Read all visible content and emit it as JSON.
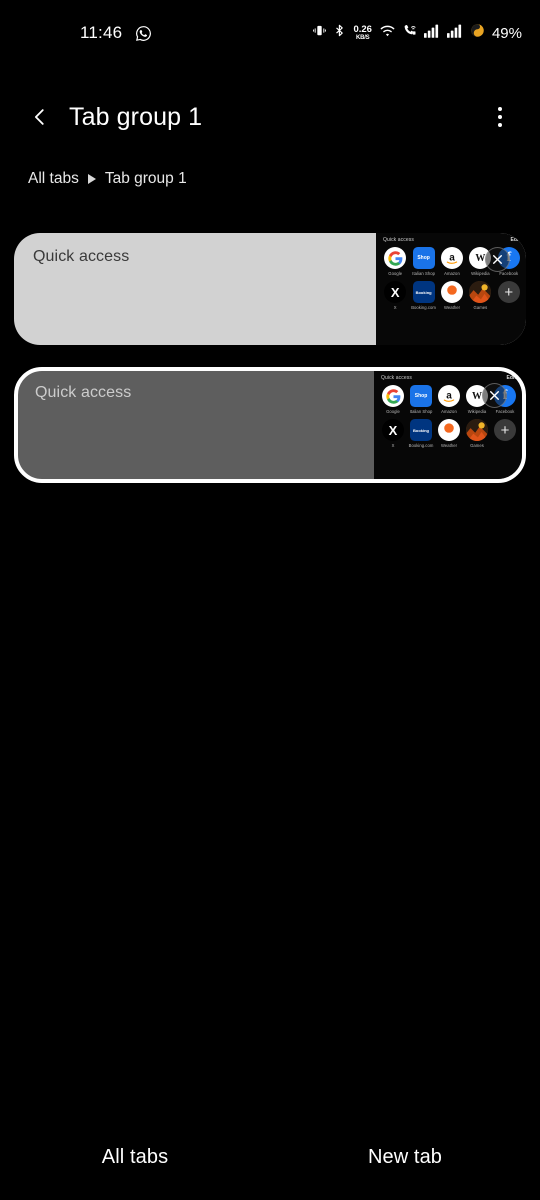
{
  "statusbar": {
    "time": "11:46",
    "whatsapp_icon": "whatsapp-icon",
    "vibrate_icon": "vibrate-icon",
    "bluetooth_icon": "bluetooth-icon",
    "network_speed_value": "0.26",
    "network_speed_unit": "KB/S",
    "wifi_icon": "wifi-icon",
    "call_icon": "call-wifi-icon",
    "signal1_icon": "signal-bars-icon",
    "signal2_icon": "signal-bars-icon",
    "battery_icon": "battery-saver-icon",
    "battery_text": "49%"
  },
  "header": {
    "back_icon": "back-chevron-icon",
    "title": "Tab group 1",
    "overflow_icon": "more-options-icon"
  },
  "breadcrumb": {
    "root": "All tabs",
    "separator_icon": "breadcrumb-arrow-icon",
    "current": "Tab group 1"
  },
  "tabs": [
    {
      "label": "Quick access",
      "selected": false,
      "close_icon": "close-icon",
      "thumbnail": {
        "title": "Quick access",
        "edit_label": "Edit",
        "shortcuts": [
          {
            "name": "Google",
            "icon": "google-icon",
            "glyph": "G"
          },
          {
            "name": "Italian Shop",
            "icon": "shop-icon",
            "glyph": "Shop"
          },
          {
            "name": "Amazon",
            "icon": "amazon-icon",
            "glyph": "a"
          },
          {
            "name": "Wikipedia",
            "icon": "wikipedia-icon",
            "glyph": "W"
          },
          {
            "name": "Facebook",
            "icon": "facebook-icon",
            "glyph": "f"
          },
          {
            "name": "X",
            "icon": "x-twitter-icon",
            "glyph": "X"
          },
          {
            "name": "Booking.com",
            "icon": "booking-icon",
            "glyph": "B"
          },
          {
            "name": "Weather",
            "icon": "weather-icon",
            "glyph": ""
          },
          {
            "name": "Games",
            "icon": "games-icon",
            "glyph": ""
          },
          {
            "name": "",
            "icon": "add-shortcut-icon",
            "glyph": "+"
          }
        ]
      }
    },
    {
      "label": "Quick access",
      "selected": true,
      "close_icon": "close-icon",
      "thumbnail": {
        "title": "Quick access",
        "edit_label": "Edit",
        "shortcuts": [
          {
            "name": "Google",
            "icon": "google-icon",
            "glyph": "G"
          },
          {
            "name": "Italian Shop",
            "icon": "shop-icon",
            "glyph": "Shop"
          },
          {
            "name": "Amazon",
            "icon": "amazon-icon",
            "glyph": "a"
          },
          {
            "name": "Wikipedia",
            "icon": "wikipedia-icon",
            "glyph": "W"
          },
          {
            "name": "Facebook",
            "icon": "facebook-icon",
            "glyph": "f"
          },
          {
            "name": "X",
            "icon": "x-twitter-icon",
            "glyph": "X"
          },
          {
            "name": "Booking.com",
            "icon": "booking-icon",
            "glyph": "B"
          },
          {
            "name": "Weather",
            "icon": "weather-icon",
            "glyph": ""
          },
          {
            "name": "Games",
            "icon": "games-icon",
            "glyph": ""
          },
          {
            "name": "",
            "icon": "add-shortcut-icon",
            "glyph": "+"
          }
        ]
      }
    }
  ],
  "bottombar": {
    "all_tabs": "All tabs",
    "new_tab": "New tab"
  },
  "colors": {
    "background": "#000000",
    "card_unselected": "#d2d2d2",
    "card_selected": "#5e5e5e",
    "selection_border": "#ffffff",
    "text_primary": "#ffffff"
  }
}
